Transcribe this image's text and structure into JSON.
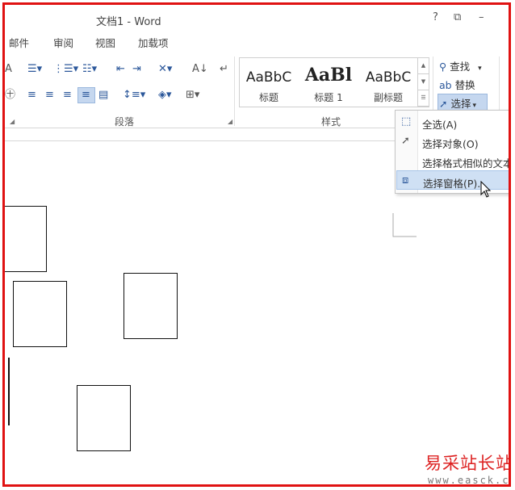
{
  "window": {
    "title": "文档1 - Word",
    "help": "?",
    "restore": "⧉",
    "minimize": "–"
  },
  "tabs": [
    "邮件",
    "审阅",
    "视图",
    "加载项"
  ],
  "ribbon": {
    "paragraph_group": "段落",
    "styles_group": "样式",
    "styles": [
      {
        "sample": "AaBbC",
        "name": "标题"
      },
      {
        "sample": "AaBl",
        "name": "标题 1"
      },
      {
        "sample": "AaBbC",
        "name": "副标题"
      }
    ],
    "editing": {
      "find": "查找",
      "replace": "替换",
      "select": "选择"
    }
  },
  "select_menu": {
    "items": [
      {
        "label": "全选(A)",
        "icon": "select-all-icon"
      },
      {
        "label": "选择对象(O)",
        "icon": "select-objects-icon"
      },
      {
        "label": "选择格式相似的文本",
        "icon": ""
      },
      {
        "label": "选择窗格(P)...",
        "icon": "selection-pane-icon"
      }
    ],
    "highlighted_index": 3
  },
  "watermark": {
    "cn": "易采站长站",
    "en": "www.easck.com"
  },
  "colors": {
    "frame": "#e01212",
    "accent": "#2b579a",
    "highlight": "#cfe0f4"
  }
}
